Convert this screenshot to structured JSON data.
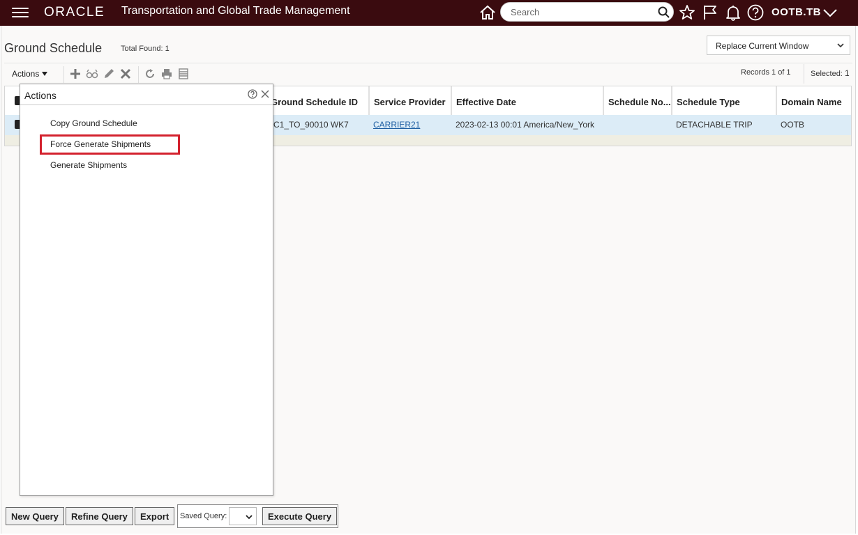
{
  "topbar": {
    "brand": "ORACLE",
    "app_title": "Transportation and Global Trade Management",
    "search_placeholder": "Search",
    "user": "OOTB.TB",
    "icons": [
      "menu-icon",
      "home-icon",
      "search-icon",
      "star-icon",
      "flag-icon",
      "bell-icon",
      "help-icon",
      "chevron-down-icon"
    ]
  },
  "page": {
    "title": "Ground Schedule",
    "total_found": "Total Found: 1",
    "window_option": "Replace Current Window"
  },
  "toolbar": {
    "actions_label": "Actions",
    "records": "Records  1  of  1",
    "selected_label": "Selected:",
    "selected_count": "1"
  },
  "table": {
    "columns": [
      "Ground Schedule ID",
      "Service Provider",
      "Effective Date",
      "Schedule No...",
      "Schedule Type",
      "Domain Name"
    ],
    "rows": [
      {
        "id": "C1_TO_90010 WK7",
        "service_provider": "CARRIER21",
        "effective_date": "2023-02-13 00:01 America/New_York",
        "schedule_no": "",
        "schedule_type": "DETACHABLE TRIP",
        "domain": "OOTB"
      }
    ]
  },
  "actions_popup": {
    "title": "Actions",
    "items": [
      "Copy Ground Schedule",
      "Force Generate Shipments",
      "Generate Shipments"
    ],
    "highlight_color": "#d3212d"
  },
  "bottom": {
    "new_query": "New Query",
    "refine_query": "Refine Query",
    "export": "Export",
    "saved_query_label": "Saved Query:",
    "execute_query": "Execute Query"
  },
  "colors": {
    "topbar_bg": "#3a0b0f",
    "row_selected": "#dcecf7",
    "link": "#1f5fa3"
  }
}
